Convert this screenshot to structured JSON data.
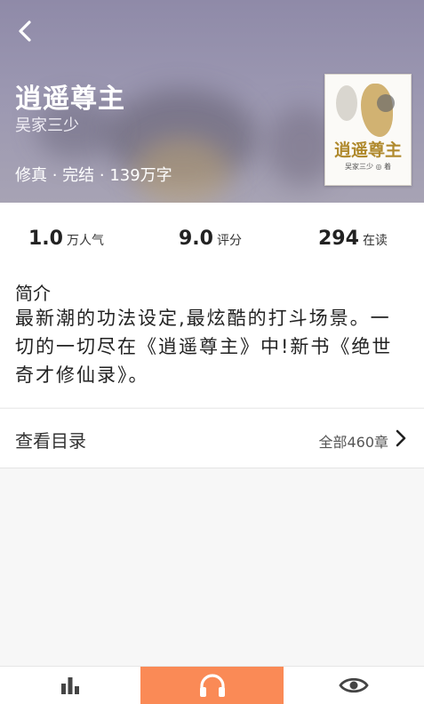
{
  "book": {
    "title": "逍遥尊主",
    "author": "吴家三少",
    "meta": "修真 · 完结 · 139万字",
    "cover": {
      "title": "逍遥尊主",
      "subtitle": "吴家三少 ◎ 着"
    }
  },
  "stats": [
    {
      "value": "1.0",
      "unit": "万人气"
    },
    {
      "value": "9.0",
      "unit": "评分"
    },
    {
      "value": "294",
      "unit": "在读"
    }
  ],
  "intro": {
    "heading": "简介",
    "text": "最新潮的功法设定,最炫酷的打斗场景。一切的一切尽在《逍遥尊主》中!新书《绝世奇才修仙录》。"
  },
  "catalog": {
    "label": "查看目录",
    "count": "全部460章"
  },
  "bottom_bar": {
    "items": [
      "bar-chart-icon",
      "headphones-icon",
      "eye-icon"
    ],
    "active_color": "#fa8a56"
  },
  "colors": {
    "header": "#9b97b1",
    "accent": "#fa8a56"
  }
}
